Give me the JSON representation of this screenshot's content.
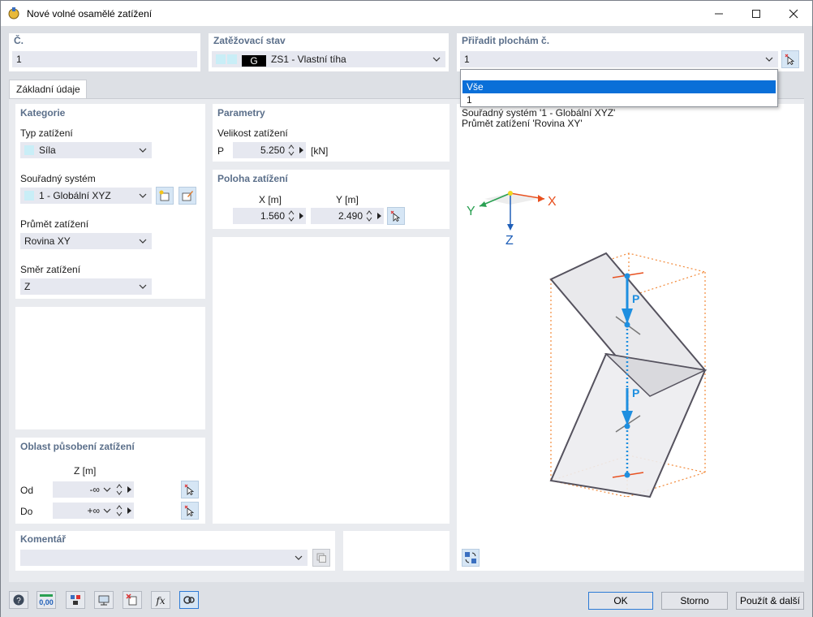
{
  "window": {
    "title": "Nové volné osamělé zatížení",
    "minimize_icon": "minimize-icon",
    "maximize_icon": "maximize-icon",
    "close_icon": "close-icon"
  },
  "header": {
    "number": {
      "label": "Č.",
      "value": "1"
    },
    "load_case": {
      "label": "Zatěžovací stav",
      "badge": "G",
      "value": "ZS1 - Vlastní tíha"
    },
    "assign_surfaces": {
      "label": "Přiřadit plochám č.",
      "value": "1"
    }
  },
  "dropdown": {
    "options": [
      "Vše",
      "1"
    ],
    "selected_index": 0
  },
  "tabs": [
    "Základní údaje"
  ],
  "category": {
    "title": "Kategorie",
    "load_type": {
      "label": "Typ zatížení",
      "value": "Síla"
    },
    "coord_system": {
      "label": "Souřadný systém",
      "value": "1 - Globální XYZ"
    },
    "projection": {
      "label": "Průmět zatížení",
      "value": "Rovina XY"
    },
    "direction": {
      "label": "Směr zatížení",
      "value": "Z"
    }
  },
  "parameters": {
    "title": "Parametry",
    "magnitude_label": "Velikost zatížení",
    "symbol": "P",
    "value": "5.250",
    "unit": "[kN]"
  },
  "position": {
    "title": "Poloha zatížení",
    "x_header": "X [m]",
    "y_header": "Y [m]",
    "x_value": "1.560",
    "y_value": "2.490"
  },
  "load_area": {
    "title": "Oblast působení zatížení",
    "z_header": "Z [m]",
    "from_label": "Od",
    "from_value": "-∞",
    "to_label": "Do",
    "to_value": "+∞"
  },
  "comment": {
    "label": "Komentář",
    "value": ""
  },
  "preview": {
    "info_line1": "Souřadný systém '1 - Globální XYZ'",
    "info_line2": "Průmět zatížení 'Rovina XY'",
    "axis_x": "X",
    "axis_y": "Y",
    "axis_z": "Z",
    "load_label_1": "P",
    "load_label_2": "P",
    "colors": {
      "x_axis": "#e8501f",
      "y_axis": "#2aa052",
      "z_axis": "#1f5fb8",
      "load": "#1e8fe0",
      "projection": "#f28a3a"
    }
  },
  "buttons": {
    "ok": "OK",
    "cancel": "Storno",
    "apply_next": "Použít & další"
  },
  "bottom_icons": [
    "help-icon",
    "decimal-places-icon",
    "units-icon",
    "model-view-icon",
    "clear-icon",
    "formula-icon",
    "settings-icon"
  ]
}
